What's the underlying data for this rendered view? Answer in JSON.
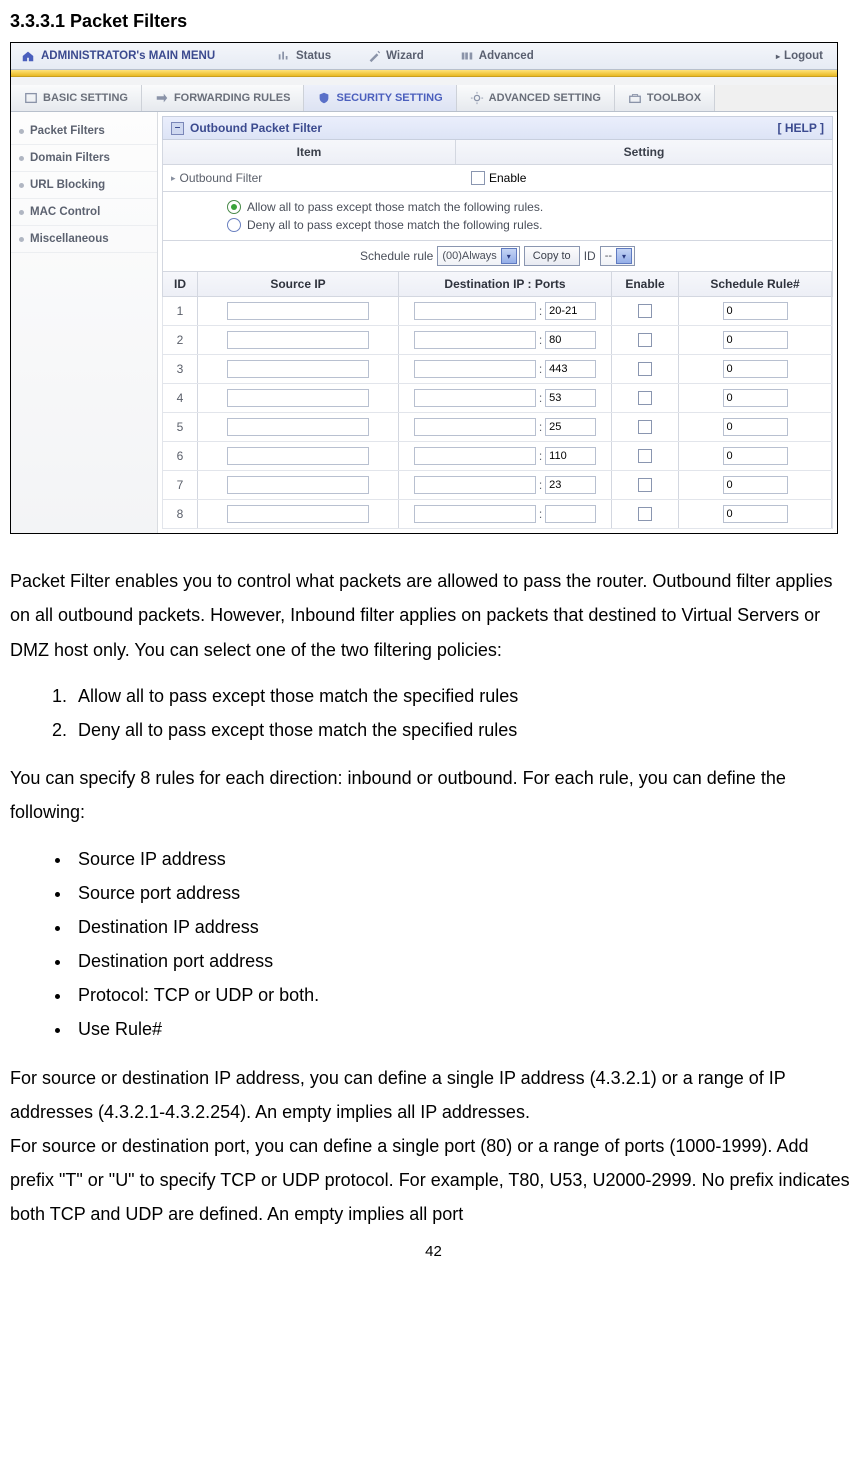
{
  "doc": {
    "section_heading": "3.3.3.1 Packet Filters",
    "para1": "Packet Filter enables you to control what packets are allowed to pass the router. Outbound filter applies on all outbound packets. However, Inbound filter applies on packets that destined to Virtual Servers or DMZ host only. You can select one of the two filtering policies:",
    "ol": [
      "Allow all to pass except those match the specified rules",
      "Deny all to pass except those match the specified rules"
    ],
    "para2": "You can specify 8 rules for each direction: inbound or outbound. For each rule, you can define the following:",
    "ul": [
      "Source IP address",
      "Source port address",
      "Destination IP address",
      "Destination port address",
      "Protocol: TCP or UDP or both.",
      "Use Rule#"
    ],
    "para3a": "For source or destination IP address, you can define a single IP address (4.3.2.1) or a range of IP addresses (4.3.2.1-4.3.2.254). An empty implies all IP addresses.",
    "para3b": "For source or destination port, you can define a single port (80) or a range of ports (1000-1999). Add prefix \"T\" or \"U\" to specify TCP or UDP protocol. For example, T80, U53, U2000-2999. No prefix indicates both TCP and UDP are defined. An empty implies all port",
    "page_number": "42"
  },
  "topbar": {
    "admin": "ADMINISTRATOR's MAIN MENU",
    "status": "Status",
    "wizard": "Wizard",
    "advanced": "Advanced",
    "logout": "Logout"
  },
  "tabs": {
    "basic": "BASIC SETTING",
    "forwarding": "FORWARDING RULES",
    "security": "SECURITY SETTING",
    "advanced": "ADVANCED SETTING",
    "toolbox": "TOOLBOX"
  },
  "sidebar": {
    "items": [
      "Packet Filters",
      "Domain Filters",
      "URL Blocking",
      "MAC Control",
      "Miscellaneous"
    ]
  },
  "panel": {
    "title": "Outbound Packet Filter",
    "help": "[ HELP ]",
    "header_item": "Item",
    "header_setting": "Setting",
    "outbound_filter_label": "Outbound Filter",
    "enable_label": "Enable",
    "radio_allow": "Allow all to pass except those match the following rules.",
    "radio_deny": "Deny all to pass except those match the following rules.",
    "schedule_label": "Schedule rule",
    "schedule_select": "(00)Always",
    "copy_btn": "Copy to",
    "id_label": "ID",
    "id_select": "--"
  },
  "rules_header": {
    "id": "ID",
    "src": "Source IP",
    "dest": "Destination IP : Ports",
    "enable": "Enable",
    "sched": "Schedule Rule#"
  },
  "rules": [
    {
      "id": "1",
      "port": "20-21",
      "sched": "0"
    },
    {
      "id": "2",
      "port": "80",
      "sched": "0"
    },
    {
      "id": "3",
      "port": "443",
      "sched": "0"
    },
    {
      "id": "4",
      "port": "53",
      "sched": "0"
    },
    {
      "id": "5",
      "port": "25",
      "sched": "0"
    },
    {
      "id": "6",
      "port": "110",
      "sched": "0"
    },
    {
      "id": "7",
      "port": "23",
      "sched": "0"
    },
    {
      "id": "8",
      "port": "",
      "sched": "0"
    }
  ]
}
